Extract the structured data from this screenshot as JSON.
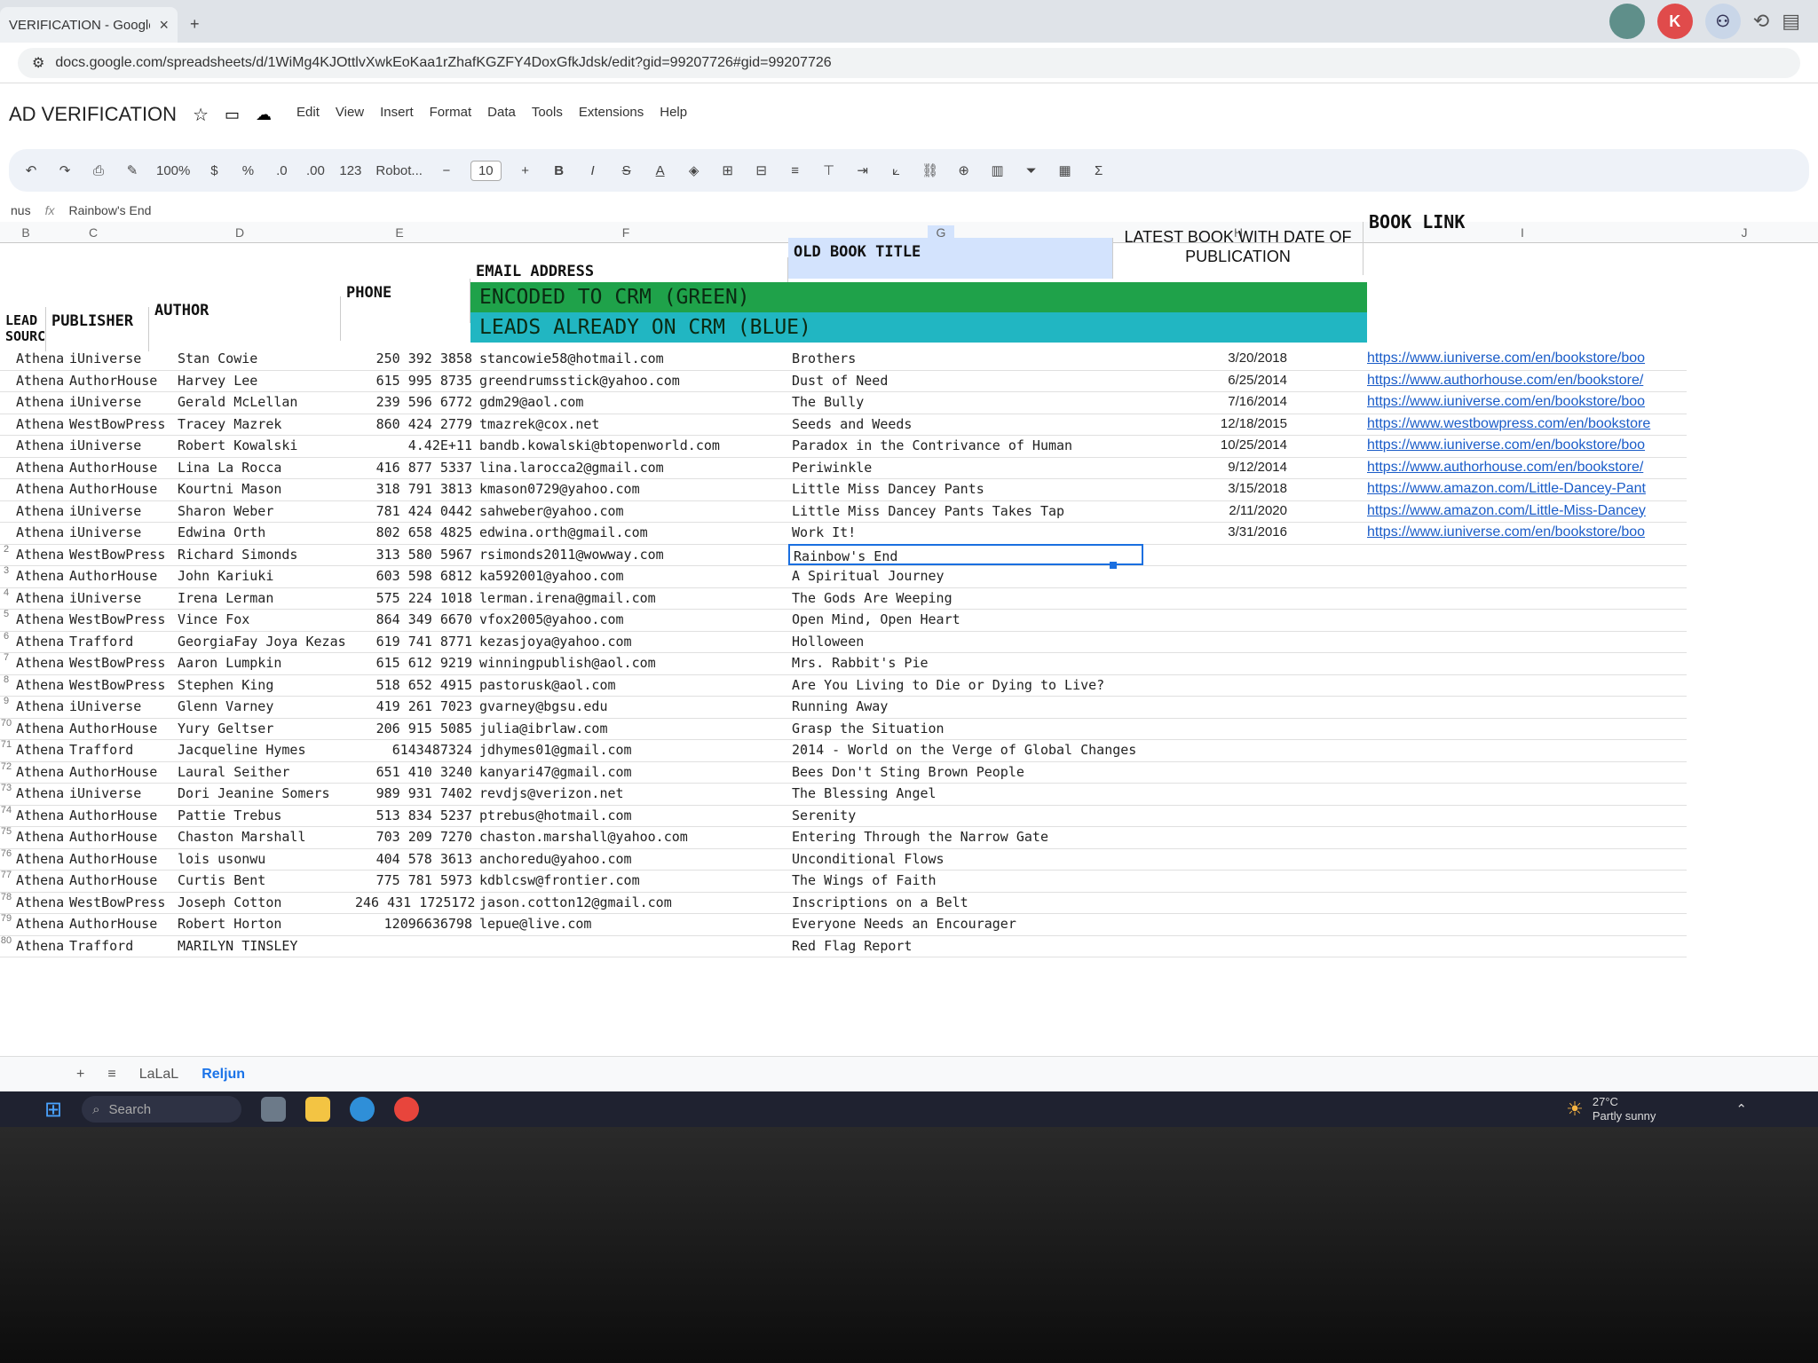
{
  "browser": {
    "tab_title": "VERIFICATION - Google",
    "tab_close": "×",
    "new_tab": "+",
    "url": "docs.google.com/spreadsheets/d/1WiMg4KJOttlvXwkEoKaa1rZhafKGZFY4DoxGfkJdsk/edit?gid=99207726#gid=99207726",
    "profile_initial": "K"
  },
  "doc": {
    "title": "AD VERIFICATION",
    "menus": [
      "Edit",
      "View",
      "Insert",
      "Format",
      "Data",
      "Tools",
      "Extensions",
      "Help"
    ],
    "zoom": "100%",
    "currency": "$",
    "percent": "%",
    "dec_less": ".0",
    "dec_more": ".00",
    "number_fmt": "123",
    "font": "Robot...",
    "font_size": "10",
    "bold": "B",
    "italic": "I",
    "strike": "S",
    "text_color": "A",
    "sum": "Σ",
    "name_box": "nus",
    "formula_value": "Rainbow's End"
  },
  "grid": {
    "col_letters": [
      "B",
      "C",
      "D",
      "E",
      "F",
      "G",
      "H",
      "I",
      "J"
    ],
    "headers": {
      "lead_source": "LEAD SOURC",
      "publisher": "PUBLISHER",
      "author": "AUTHOR",
      "phone": "PHONE",
      "email": "EMAIL ADDRESS",
      "old_title": "OLD BOOK TITLE",
      "latest_book": "LATEST BOOK WITH DATE OF PUBLICATION",
      "book_link": "BOOK LINK"
    },
    "band_green": "ENCODED TO CRM (GREEN)",
    "band_blue": "LEADS ALREADY ON CRM (BLUE)",
    "rows": [
      {
        "row": "",
        "src": "Athena",
        "pub": "iUniverse",
        "author": "Stan Cowie",
        "phone": "250 392 3858",
        "email": "stancowie58@hotmail.com",
        "title": "Brothers",
        "date": "3/20/2018",
        "link": "https://www.iuniverse.com/en/bookstore/boo"
      },
      {
        "row": "",
        "src": "Athena",
        "pub": "AuthorHouse",
        "author": "Harvey Lee",
        "phone": "615 995 8735",
        "email": "greendrumsstick@yahoo.com",
        "title": "Dust of Need",
        "date": "6/25/2014",
        "link": "https://www.authorhouse.com/en/bookstore/"
      },
      {
        "row": "",
        "src": "Athena",
        "pub": "iUniverse",
        "author": "Gerald McLellan",
        "phone": "239 596 6772",
        "email": "gdm29@aol.com",
        "title": "The Bully",
        "date": "7/16/2014",
        "link": "https://www.iuniverse.com/en/bookstore/boo"
      },
      {
        "row": "",
        "src": "Athena",
        "pub": "WestBowPress",
        "author": "Tracey Mazrek",
        "phone": "860 424 2779",
        "email": "tmazrek@cox.net",
        "title": "Seeds and Weeds",
        "date": "12/18/2015",
        "link": "https://www.westbowpress.com/en/bookstore"
      },
      {
        "row": "",
        "src": "Athena",
        "pub": "iUniverse",
        "author": "Robert Kowalski",
        "phone": "4.42E+11",
        "email": "bandb.kowalski@btopenworld.com",
        "title": "Paradox in the Contrivance of Human",
        "date": "10/25/2014",
        "link": "https://www.iuniverse.com/en/bookstore/boo"
      },
      {
        "row": "",
        "src": "Athena",
        "pub": "AuthorHouse",
        "author": "Lina La Rocca",
        "phone": "416 877 5337",
        "email": "lina.larocca2@gmail.com",
        "title": "Periwinkle",
        "date": "9/12/2014",
        "link": "https://www.authorhouse.com/en/bookstore/"
      },
      {
        "row": "",
        "src": "Athena",
        "pub": "AuthorHouse",
        "author": "Kourtni Mason",
        "phone": "318 791 3813",
        "email": "kmason0729@yahoo.com",
        "title": "Little Miss Dancey Pants",
        "date": "3/15/2018",
        "link": "https://www.amazon.com/Little-Dancey-Pant"
      },
      {
        "row": "",
        "src": "Athena",
        "pub": "iUniverse",
        "author": "Sharon Weber",
        "phone": "781 424 0442",
        "email": "sahweber@yahoo.com",
        "title": "Little Miss Dancey Pants Takes Tap",
        "date": "2/11/2020",
        "link": "https://www.amazon.com/Little-Miss-Dancey"
      },
      {
        "row": "",
        "src": "Athena",
        "pub": "iUniverse",
        "author": "Edwina Orth",
        "phone": "802 658 4825",
        "email": "edwina.orth@gmail.com",
        "title": "Work It!",
        "date": "3/31/2016",
        "link": "https://www.iuniverse.com/en/bookstore/boo"
      },
      {
        "row": "2",
        "src": "Athena",
        "pub": "WestBowPress",
        "author": "Richard Simonds",
        "phone": "313 580 5967",
        "email": "rsimonds2011@wowway.com",
        "title": "Rainbow's End",
        "date": "",
        "link": ""
      },
      {
        "row": "3",
        "src": "Athena",
        "pub": "AuthorHouse",
        "author": "John Kariuki",
        "phone": "603 598 6812",
        "email": "ka592001@yahoo.com",
        "title": "A Spiritual Journey",
        "date": "",
        "link": ""
      },
      {
        "row": "4",
        "src": "Athena",
        "pub": "iUniverse",
        "author": "Irena Lerman",
        "phone": "575 224 1018",
        "email": "lerman.irena@gmail.com",
        "title": "The Gods Are Weeping",
        "date": "",
        "link": ""
      },
      {
        "row": "5",
        "src": "Athena",
        "pub": "WestBowPress",
        "author": "Vince Fox",
        "phone": "864 349 6670",
        "email": "vfox2005@yahoo.com",
        "title": "Open Mind, Open Heart",
        "date": "",
        "link": ""
      },
      {
        "row": "6",
        "src": "Athena",
        "pub": "Trafford",
        "author": "GeorgiaFay Joya Kezas",
        "phone": "619 741 8771",
        "email": "kezasjoya@yahoo.com",
        "title": "Holloween",
        "date": "",
        "link": ""
      },
      {
        "row": "7",
        "src": "Athena",
        "pub": "WestBowPress",
        "author": "Aaron Lumpkin",
        "phone": "615 612 9219",
        "email": "winningpublish@aol.com",
        "title": "Mrs. Rabbit's Pie",
        "date": "",
        "link": ""
      },
      {
        "row": "8",
        "src": "Athena",
        "pub": "WestBowPress",
        "author": "Stephen King",
        "phone": "518 652 4915",
        "email": "pastorusk@aol.com",
        "title": "Are You Living to Die or Dying to Live?",
        "date": "",
        "link": ""
      },
      {
        "row": "9",
        "src": "Athena",
        "pub": "iUniverse",
        "author": "Glenn Varney",
        "phone": "419 261 7023",
        "email": "gvarney@bgsu.edu",
        "title": "Running Away",
        "date": "",
        "link": ""
      },
      {
        "row": "70",
        "src": "Athena",
        "pub": "AuthorHouse",
        "author": "Yury Geltser",
        "phone": "206 915 5085",
        "email": "julia@ibrlaw.com",
        "title": "Grasp the Situation",
        "date": "",
        "link": ""
      },
      {
        "row": "71",
        "src": "Athena",
        "pub": "Trafford",
        "author": "Jacqueline Hymes",
        "phone": "6143487324",
        "email": "jdhymes01@gmail.com",
        "title": "2014 - World on the Verge of Global Changes",
        "date": "",
        "link": ""
      },
      {
        "row": "72",
        "src": "Athena",
        "pub": "AuthorHouse",
        "author": "Laural Seither",
        "phone": "651 410 3240",
        "email": "kanyari47@gmail.com",
        "title": "Bees Don't Sting Brown People",
        "date": "",
        "link": ""
      },
      {
        "row": "73",
        "src": "Athena",
        "pub": "iUniverse",
        "author": "Dori Jeanine Somers",
        "phone": "989 931 7402",
        "email": "revdjs@verizon.net",
        "title": "The Blessing Angel",
        "date": "",
        "link": ""
      },
      {
        "row": "74",
        "src": "Athena",
        "pub": "AuthorHouse",
        "author": "Pattie Trebus",
        "phone": "513 834 5237",
        "email": "ptrebus@hotmail.com",
        "title": "Serenity",
        "date": "",
        "link": ""
      },
      {
        "row": "75",
        "src": "Athena",
        "pub": "AuthorHouse",
        "author": "Chaston Marshall",
        "phone": "703 209 7270",
        "email": "chaston.marshall@yahoo.com",
        "title": "Entering Through the Narrow Gate",
        "date": "",
        "link": ""
      },
      {
        "row": "76",
        "src": "Athena",
        "pub": "AuthorHouse",
        "author": "lois usonwu",
        "phone": "404 578 3613",
        "email": "anchoredu@yahoo.com",
        "title": "Unconditional Flows",
        "date": "",
        "link": ""
      },
      {
        "row": "77",
        "src": "Athena",
        "pub": "AuthorHouse",
        "author": "Curtis Bent",
        "phone": "775 781 5973",
        "email": "kdblcsw@frontier.com",
        "title": "The Wings of Faith",
        "date": "",
        "link": ""
      },
      {
        "row": "78",
        "src": "Athena",
        "pub": "WestBowPress",
        "author": "Joseph Cotton",
        "phone": "246 431 1725172",
        "email": "jason.cotton12@gmail.com",
        "title": "Inscriptions on a Belt",
        "date": "",
        "link": ""
      },
      {
        "row": "79",
        "src": "Athena",
        "pub": "AuthorHouse",
        "author": "Robert Horton",
        "phone": "12096636798",
        "email": "lepue@live.com",
        "title": "Everyone Needs an Encourager",
        "date": "",
        "link": ""
      },
      {
        "row": "80",
        "src": "Athena",
        "pub": "Trafford",
        "author": "MARILYN TINSLEY",
        "phone": "",
        "email": "",
        "title": "Red Flag Report",
        "date": "",
        "link": ""
      }
    ]
  },
  "sheets": {
    "add": "+",
    "all": "≡",
    "tab1": "LaLaL",
    "tab2": "Reljun"
  },
  "taskbar": {
    "search": "Search",
    "temp": "27°C",
    "weather": "Partly sunny"
  }
}
